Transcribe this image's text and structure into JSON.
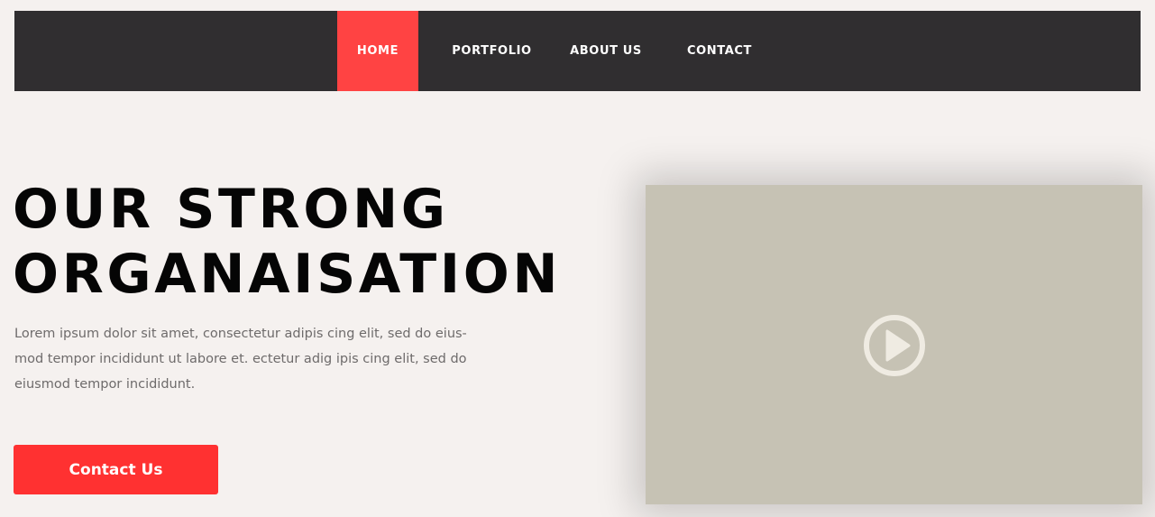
{
  "nav": {
    "items": [
      {
        "label": "HOME",
        "active": true
      },
      {
        "label": "PORTFOLIO",
        "active": false
      },
      {
        "label": "ABOUT US",
        "active": false
      },
      {
        "label": "CONTACT",
        "active": false
      }
    ]
  },
  "hero": {
    "title_line1": "OUR STRONG",
    "title_line2": "ORGANAISATION",
    "text_line1": "Lorem ipsum dolor sit amet, consectetur adipis cing elit, sed do eius-",
    "text_line2": "mod tempor incididunt  ut labore et. ectetur adig ipis cing elit, sed do",
    "text_line3": "eiusmod tempor incididunt.",
    "button_label": "Contact Us"
  },
  "video": {
    "play_icon": "play-circle-icon"
  },
  "colors": {
    "background": "#f5f1ef",
    "navbar": "#302e30",
    "accent": "#ff4343",
    "button": "#ff3131",
    "video_placeholder": "#c6c2b4",
    "play_icon": "#efebe2"
  }
}
